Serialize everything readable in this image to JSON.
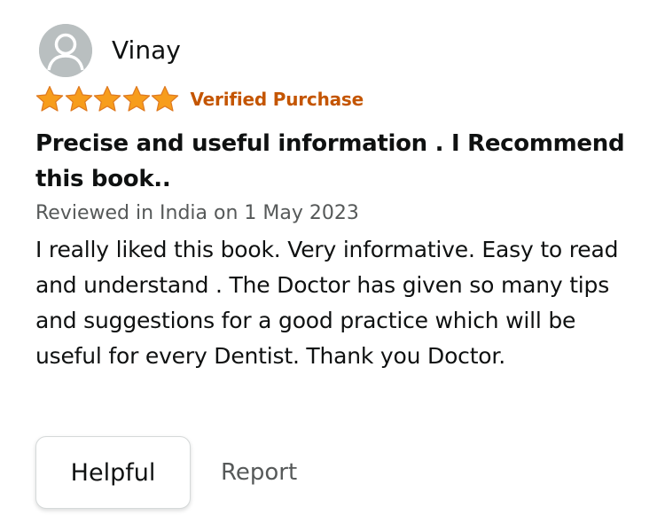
{
  "reviewer": {
    "name": "Vinay",
    "avatar_icon": "default-user-avatar-icon"
  },
  "rating": {
    "stars": 5,
    "max_stars": 5,
    "star_color": "#f79d1c",
    "verified_label": "Verified Purchase",
    "verified_color": "#c45500"
  },
  "review": {
    "title": "Precise and useful information . I Recommend this book..",
    "date_line": "Reviewed in India on 1 May 2023",
    "body": "I really liked this book. Very informative. Easy to read and understand . The Doctor has given so many tips and suggestions for a good practice which will be useful for every Dentist. Thank you Doctor."
  },
  "actions": {
    "helpful_label": "Helpful",
    "report_label": "Report"
  }
}
